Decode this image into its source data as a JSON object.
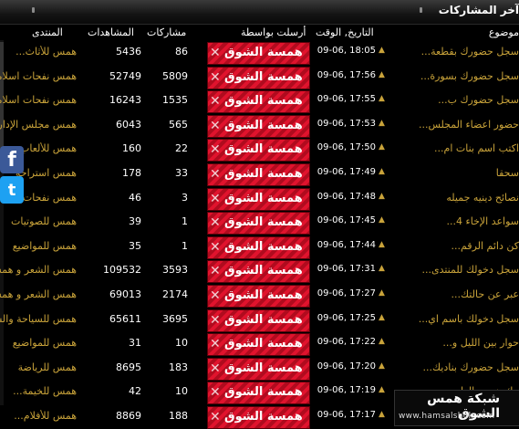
{
  "header": {
    "title": "آخر المشاركات"
  },
  "columns": {
    "topic": "موضوع",
    "datetime": "التاريخ, الوقت",
    "poster": "أرسلت بواسطة",
    "posts": "مشاركات",
    "views": "المشاهدات",
    "forum": "المنتدى"
  },
  "rows": [
    {
      "topic": "سجل حضورك بقطعة...",
      "date": "09-06, 18:05",
      "poster": "همسة الشوق",
      "posts": "86",
      "views": "5436",
      "forum": "همس للأثاث..."
    },
    {
      "topic": "سجل حضورك بسورة...",
      "date": "09-06, 17:56",
      "poster": "همسة الشوق",
      "posts": "5809",
      "views": "52749",
      "forum": "همس نفحات اسلامية"
    },
    {
      "topic": "سجل حضورك ب...",
      "date": "09-06, 17:55",
      "poster": "همسة الشوق",
      "posts": "1535",
      "views": "16243",
      "forum": "همس نفحات اسلامية"
    },
    {
      "topic": "حضور اعضاء المجلس...",
      "date": "09-06, 17:53",
      "poster": "همسة الشوق",
      "posts": "565",
      "views": "6043",
      "forum": "همس مجلس الإدارة"
    },
    {
      "topic": "اكتب اسم بنات ام...",
      "date": "09-06, 17:50",
      "poster": "همسة الشوق",
      "posts": "22",
      "views": "160",
      "forum": "همس للألعاب"
    },
    {
      "topic": "سحقا",
      "date": "09-06, 17:49",
      "poster": "همسة الشوق",
      "posts": "33",
      "views": "178",
      "forum": "همس استراحة"
    },
    {
      "topic": "نصائح دينيه جميله",
      "date": "09-06, 17:48",
      "poster": "همسة الشوق",
      "posts": "3",
      "views": "46",
      "forum": "همس نفحات"
    },
    {
      "topic": "سواعد الإخاء 4...",
      "date": "09-06, 17:45",
      "poster": "همسة الشوق",
      "posts": "1",
      "views": "39",
      "forum": "همس للصوتيات"
    },
    {
      "topic": "كن دائم الرقم...",
      "date": "09-06, 17:44",
      "poster": "همسة الشوق",
      "posts": "1",
      "views": "35",
      "forum": "همس للمواضيع"
    },
    {
      "topic": "سجل دخولك للمنتدى...",
      "date": "09-06, 17:31",
      "poster": "همسة الشوق",
      "posts": "3593",
      "views": "109532",
      "forum": "همس الشعر و همس"
    },
    {
      "topic": "عبر عن حالتك...",
      "date": "09-06, 17:27",
      "poster": "همسة الشوق",
      "posts": "2174",
      "views": "69013",
      "forum": "همس الشعر و همس"
    },
    {
      "topic": "سجل دخولك باسم اي...",
      "date": "09-06, 17:25",
      "poster": "همسة الشوق",
      "posts": "3695",
      "views": "65611",
      "forum": "همس للسياحة والسفر"
    },
    {
      "topic": "حوار بين الليل و...",
      "date": "09-06, 17:22",
      "poster": "همسة الشوق",
      "posts": "10",
      "views": "31",
      "forum": "همس للمواضيع"
    },
    {
      "topic": "سجل حضورك بناديك...",
      "date": "09-06, 17:20",
      "poster": "همسة الشوق",
      "posts": "183",
      "views": "8695",
      "forum": "همس للرياضة"
    },
    {
      "topic": "بيك همس الطبي...",
      "date": "09-06, 17:19",
      "poster": "همسة الشوق",
      "posts": "10",
      "views": "42",
      "forum": "همس للخيمة..."
    },
    {
      "topic": "...",
      "date": "09-06, 17:17",
      "poster": "همسة الشوق",
      "posts": "188",
      "views": "8869",
      "forum": "همس للأفلام..."
    }
  ],
  "social": {
    "facebook": "f",
    "twitter": "t"
  },
  "watermark": {
    "name": "شبكة همس الشوق",
    "url": "www.hamsalshok.com"
  }
}
